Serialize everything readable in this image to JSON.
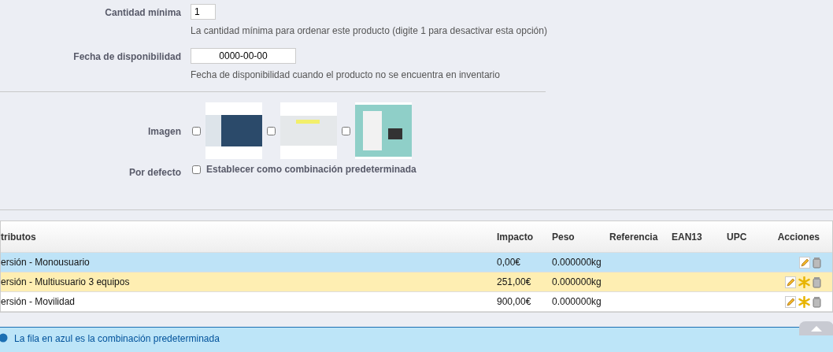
{
  "form": {
    "min_quantity": {
      "label": "Cantidad mínima",
      "value": "1",
      "hint": "La cantidad mínima para ordenar este producto (digite 1 para desactivar esta opción)"
    },
    "availability": {
      "label": "Fecha de disponibilidad",
      "value": "0000-00-00",
      "hint": "Fecha de disponibilidad cuando el producto no se encuentra en inventario"
    },
    "image": {
      "label": "Imagen",
      "options": [
        {
          "checked": false,
          "kind": "servers"
        },
        {
          "checked": false,
          "kind": "screen"
        },
        {
          "checked": false,
          "kind": "box"
        }
      ]
    },
    "default": {
      "label": "Por defecto",
      "checked": false,
      "text": "Establecer como combinación predeterminada"
    }
  },
  "table": {
    "columns": [
      "tributos",
      "Impacto",
      "Peso",
      "Referencia",
      "EAN13",
      "UPC",
      "Acciones"
    ],
    "rows": [
      {
        "cells": [
          "ersión - Monousuario",
          "0,00€",
          "0.000000kg",
          "",
          "",
          ""
        ],
        "selected": true,
        "highlighted": false,
        "can_set_default": false
      },
      {
        "cells": [
          "ersión - Multiusuario 3 equipos",
          "251,00€",
          "0.000000kg",
          "",
          "",
          ""
        ],
        "selected": false,
        "highlighted": true,
        "can_set_default": true
      },
      {
        "cells": [
          "ersión - Movilidad",
          "900,00€",
          "0.000000kg",
          "",
          "",
          ""
        ],
        "selected": false,
        "highlighted": false,
        "can_set_default": true
      }
    ]
  },
  "info": {
    "text": "La fila en azul es la combinación predeterminada"
  }
}
